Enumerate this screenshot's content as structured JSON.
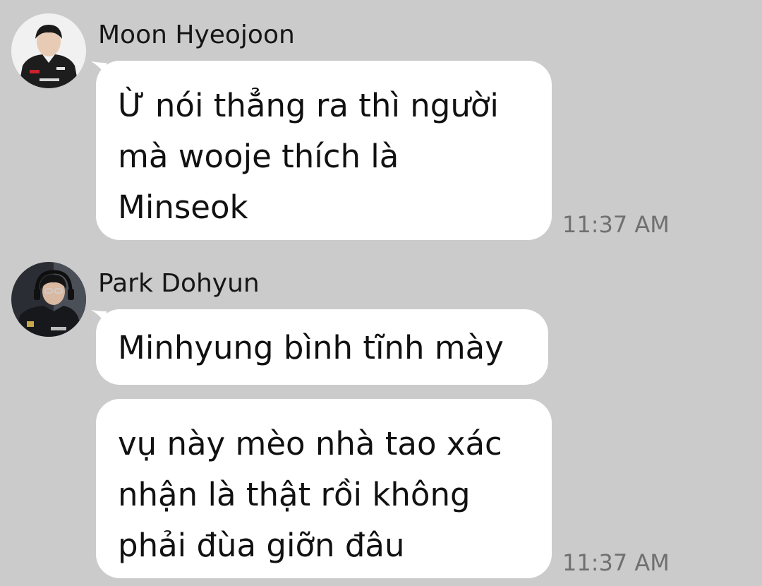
{
  "theme": {
    "background": "#cbcbcb",
    "bubble": "#ffffff",
    "text": "#111111",
    "time": "#707070"
  },
  "messages": [
    {
      "sender": "Moon Hyeojoon",
      "avatar_icon": "user-avatar-icon",
      "bubbles": [
        {
          "text": "Ừ nói thẳng ra thì người\nmà wooje thích là\nMinseok",
          "time": "11:37 AM"
        }
      ]
    },
    {
      "sender": "Park Dohyun",
      "avatar_icon": "user-avatar-icon",
      "bubbles": [
        {
          "text": "Minhyung bình tĩnh mày",
          "time": ""
        },
        {
          "text": "vụ này mèo nhà tao xác\nnhận là thật rồi không\nphải đùa giỡn đâu",
          "time": "11:37 AM"
        }
      ]
    }
  ]
}
